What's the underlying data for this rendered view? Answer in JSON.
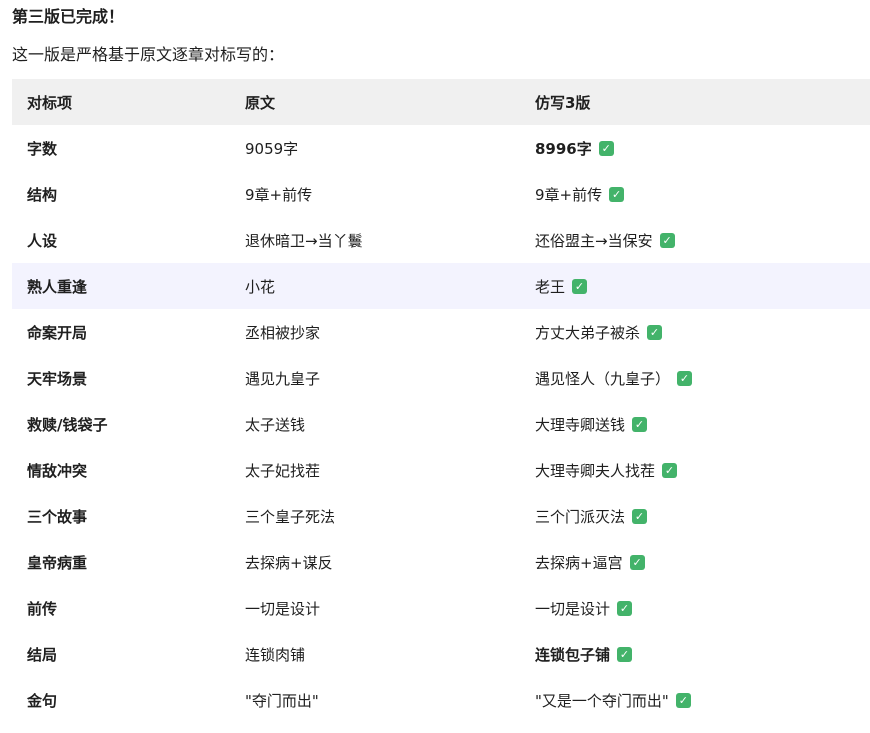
{
  "heading": "第三版已完成！",
  "intro": "这一版是严格基于原文逐章对标写的：",
  "table": {
    "headers": [
      "对标项",
      "原文",
      "仿写3版"
    ],
    "rows": [
      {
        "item": "字数",
        "original": "9059字",
        "rewrite": "8996字",
        "rewrite_bold": true,
        "checked": true
      },
      {
        "item": "结构",
        "original": "9章+前传",
        "rewrite": "9章+前传",
        "rewrite_bold": false,
        "checked": true
      },
      {
        "item": "人设",
        "original": "退休暗卫→当丫鬟",
        "rewrite": "还俗盟主→当保安",
        "rewrite_bold": false,
        "checked": true
      },
      {
        "item": "熟人重逢",
        "original": "小花",
        "rewrite": "老王",
        "rewrite_bold": false,
        "checked": true
      },
      {
        "item": "命案开局",
        "original": "丞相被抄家",
        "rewrite": "方丈大弟子被杀",
        "rewrite_bold": false,
        "checked": true
      },
      {
        "item": "天牢场景",
        "original": "遇见九皇子",
        "rewrite": "遇见怪人（九皇子）",
        "rewrite_bold": false,
        "checked": true
      },
      {
        "item": "救赎/钱袋子",
        "original": "太子送钱",
        "rewrite": "大理寺卿送钱",
        "rewrite_bold": false,
        "checked": true
      },
      {
        "item": "情敌冲突",
        "original": "太子妃找茬",
        "rewrite": "大理寺卿夫人找茬",
        "rewrite_bold": false,
        "checked": true
      },
      {
        "item": "三个故事",
        "original": "三个皇子死法",
        "rewrite": "三个门派灭法",
        "rewrite_bold": false,
        "checked": true
      },
      {
        "item": "皇帝病重",
        "original": "去探病+谋反",
        "rewrite": "去探病+逼宫",
        "rewrite_bold": false,
        "checked": true
      },
      {
        "item": "前传",
        "original": "一切是设计",
        "rewrite": "一切是设计",
        "rewrite_bold": false,
        "checked": true
      },
      {
        "item": "结局",
        "original": "连锁肉铺",
        "rewrite": "连锁包子铺",
        "rewrite_bold": true,
        "checked": true
      },
      {
        "item": "金句",
        "original": "\"夺门而出\"",
        "rewrite": "\"又是一个夺门而出\"",
        "rewrite_bold": false,
        "checked": true
      }
    ],
    "highlighted_row": 3
  },
  "check_icon": "✓",
  "colors": {
    "header_bg": "#f0f0f0",
    "highlight_bg": "#f3f3fe",
    "check_bg": "#43b36a"
  }
}
